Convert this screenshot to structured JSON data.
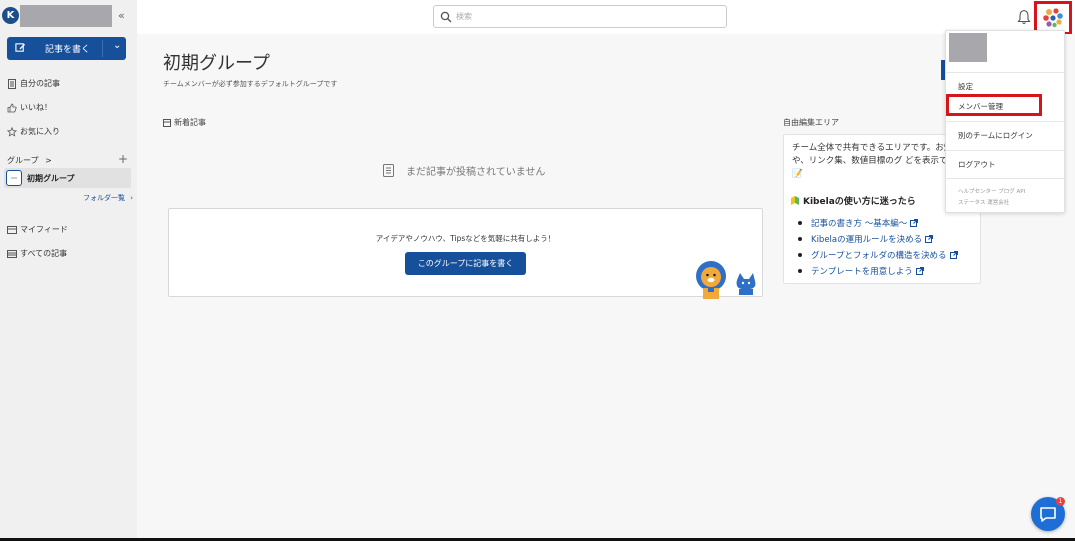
{
  "sidebar": {
    "logo_letter": "K",
    "collapse_icon": "«",
    "write_button": {
      "label": "記事を書く",
      "chevron": "⌄"
    },
    "nav": [
      {
        "label": "自分の記事",
        "icon": "document-icon"
      },
      {
        "label": "いいね！",
        "icon": "thumbs-up-icon"
      },
      {
        "label": "お気に入り",
        "icon": "star-icon"
      }
    ],
    "group_heading": "グループ",
    "group_heading_arrow": ">",
    "add_group": "+",
    "group_item": "初期グループ",
    "folder_link": "フォルダ一覧",
    "nav2": [
      {
        "label": "マイフィード",
        "icon": "feed-icon"
      },
      {
        "label": "すべての記事",
        "icon": "all-articles-icon"
      }
    ]
  },
  "header": {
    "search_placeholder": "検索"
  },
  "main": {
    "title": "初期グループ",
    "subtitle": "チームメンバーが必ず参加するデフォルトグループです",
    "new_articles_label": "新着記事",
    "empty_message": "まだ記事が投稿されていません",
    "share_prompt": "アイデアやノウハウ、Tipsなどを気軽に共有しよう！",
    "share_button": "このグループに記事を書く",
    "edit_area_label": "自由編集エリア",
    "edit_area_text": "チーム全体で共有できるエリアです。お知らせや、リンク集、数値目標のグ どを表示できます",
    "kibela_heading": "Kibelaの使い方に迷ったら",
    "links": [
      "記事の書き方 〜基本編〜",
      "Kibelaの運用ルールを決める",
      "グループとフォルダの構造を決める",
      "テンプレートを用意しよう"
    ]
  },
  "dropdown": {
    "settings": "設定",
    "member_management": "メンバー管理",
    "login_other_team": "別のチームにログイン",
    "logout": "ログアウト",
    "footer_line1": "ヘルプセンター  ブログ  API",
    "footer_line2": "ステータス  運営会社"
  },
  "chat": {
    "badge": "1"
  },
  "colors": {
    "brand": "#16509b",
    "highlight": "#d8141b"
  }
}
